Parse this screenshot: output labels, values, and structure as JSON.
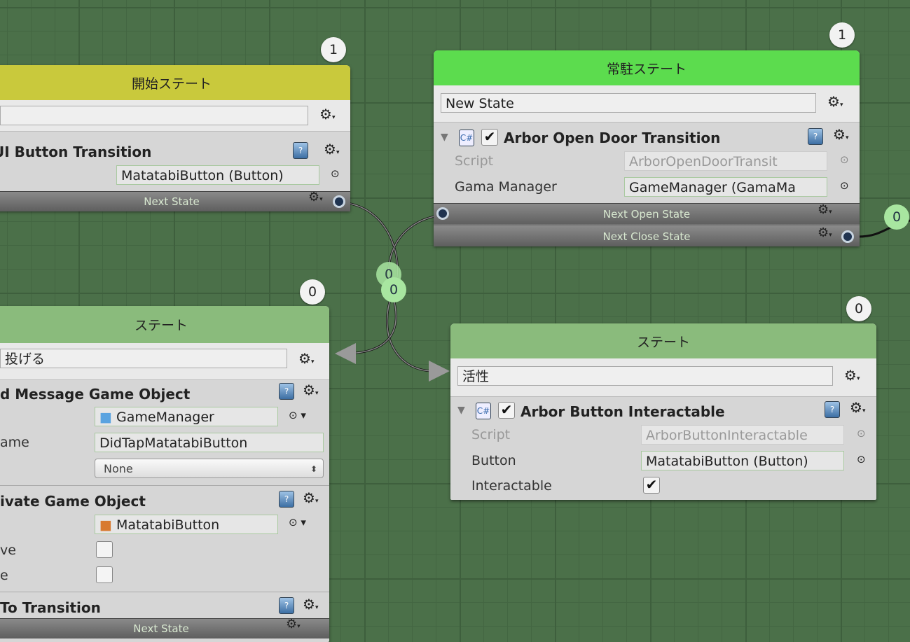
{
  "nodes": {
    "start": {
      "title": "開始ステート",
      "count": "1",
      "name": "",
      "behaviour": "UI Button Transition",
      "field_value": "MatatabiButton (Button)",
      "next_state": "Next State",
      "color": "#c9c93c"
    },
    "resident": {
      "title": "常駐ステート",
      "count": "1",
      "name": "New State",
      "behaviour": "Arbor Open Door Transition",
      "script_label": "Script",
      "script_value": "ArborOpenDoorTransit",
      "manager_label": "Gama Manager",
      "manager_value": "GameManager (GamaMa",
      "next_open": "Next Open State",
      "next_close": "Next Close State",
      "color": "#5cdc4e"
    },
    "throw": {
      "title": "ステート",
      "count": "0",
      "name": "投げる",
      "b1": "d Message Game Object",
      "b1_target": "GameManager",
      "b1_method_label": "ame",
      "b1_method": "DidTapMatatabiButton",
      "b1_option": "None",
      "b2": "ivate Game Object",
      "b2_target": "MatatabiButton",
      "b2_active_label": "ve",
      "b2_other_label": "e",
      "b3": " To Transition",
      "next_state": "Next State",
      "color": "#8abb7c"
    },
    "activate": {
      "title": "ステート",
      "count": "0",
      "name": "活性",
      "behaviour": "Arbor Button Interactable",
      "script_label": "Script",
      "script_value": "ArborButtonInteractable",
      "button_label": "Button",
      "button_value": "MatatabiButton (Button)",
      "interactable_label": "Interactable",
      "color": "#8abb7c"
    }
  },
  "connectors": {
    "badge_a": "0",
    "badge_b": "0",
    "badge_right": "0"
  }
}
